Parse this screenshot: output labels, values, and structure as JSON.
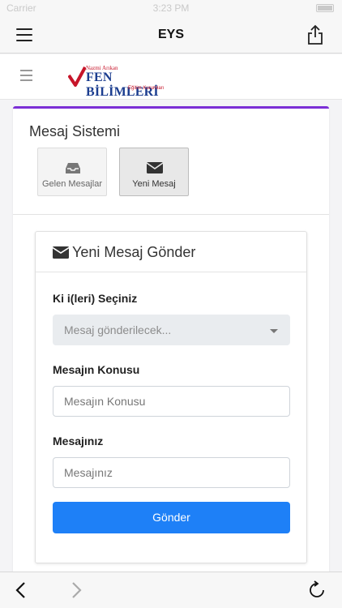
{
  "status_bar": {
    "carrier": "Carrier",
    "time": "3:23 PM"
  },
  "app_bar": {
    "title": "EYS"
  },
  "site": {
    "logo": {
      "small": "Nazmi Arıkan",
      "big": "FEN BİLİMLERİ",
      "sub": "Eğitim Kurumları"
    }
  },
  "message_system": {
    "title": "Mesaj Sistemi",
    "tiles": [
      {
        "label": "Gelen Mesajlar",
        "icon": "inbox-icon"
      },
      {
        "label": "Yeni Mesaj",
        "icon": "envelope-icon"
      }
    ]
  },
  "form": {
    "title": "Yeni Mesaj Gönder",
    "recipients_label": "Ki  i(leri) Seçiniz",
    "recipients_placeholder": "Mesaj gönderilecek...",
    "subject_label": "Mesajın Konusu",
    "subject_placeholder": "Mesajın Konusu",
    "message_label": "Mesajınız",
    "message_placeholder": "Mesajınız",
    "submit_label": "Gönder"
  },
  "colors": {
    "accent": "#7b2fd6",
    "primary_button": "#1e80f7"
  }
}
